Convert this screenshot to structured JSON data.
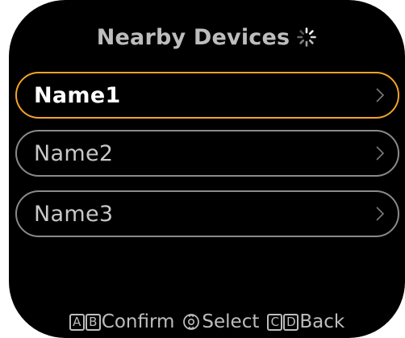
{
  "header": {
    "title": "Nearby Devices",
    "spinner_icon": "loading-spinner-icon"
  },
  "devices": [
    {
      "label": "Name1",
      "selected": true,
      "chevron_icon": "chevron-right-icon"
    },
    {
      "label": "Name2",
      "selected": false,
      "chevron_icon": "chevron-right-icon"
    },
    {
      "label": "Name3",
      "selected": false,
      "chevron_icon": "chevron-right-icon"
    }
  ],
  "footer": {
    "confirm": {
      "keys": [
        "A",
        "B"
      ],
      "label": "Confirm"
    },
    "select": {
      "icon": "dial-icon",
      "label": "Select"
    },
    "back": {
      "keys": [
        "C",
        "D"
      ],
      "label": "Back"
    }
  },
  "colors": {
    "background": "#000000",
    "selected_border": "#f4a32c",
    "item_border": "#8a8a8a",
    "text": "#bdbdbd"
  }
}
